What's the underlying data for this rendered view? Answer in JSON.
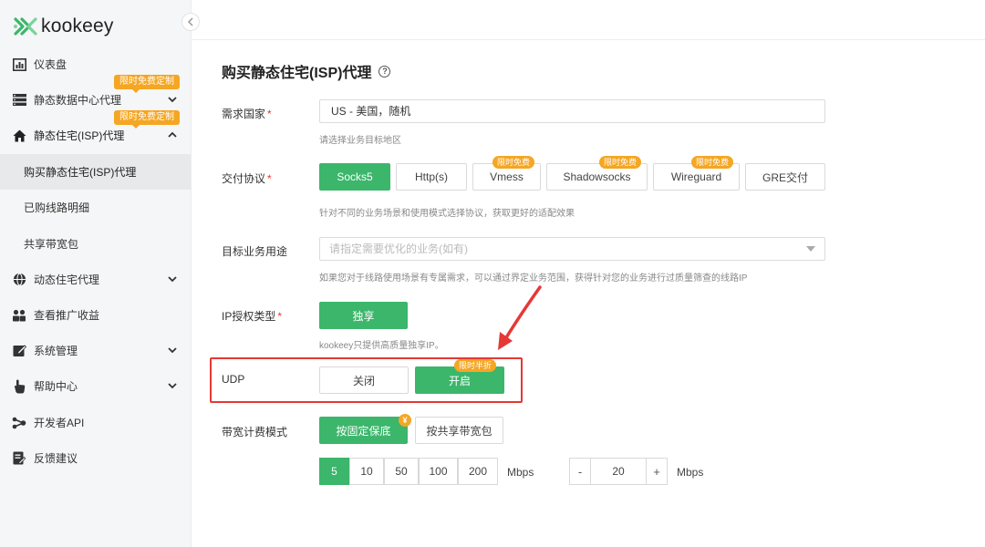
{
  "brand": {
    "name": "kookeey",
    "color": "#3bb66b"
  },
  "sidebar": {
    "collapse_icon": "chevron-left-icon",
    "items": [
      {
        "label": "仪表盘",
        "icon": "dashboard-icon"
      },
      {
        "label": "静态数据中心代理",
        "icon": "server-icon",
        "badge": "限时免费定制"
      },
      {
        "label": "静态住宅(ISP)代理",
        "icon": "home-icon",
        "badge": "限时免费定制"
      },
      {
        "label": "购买静态住宅(ISP)代理"
      },
      {
        "label": "已购线路明细"
      },
      {
        "label": "共享带宽包"
      },
      {
        "label": "动态住宅代理",
        "icon": "globe-icon"
      },
      {
        "label": "查看推广收益",
        "icon": "users-icon"
      },
      {
        "label": "系统管理",
        "icon": "edit-icon"
      },
      {
        "label": "帮助中心",
        "icon": "hand-icon"
      },
      {
        "label": "开发者API",
        "icon": "api-icon"
      },
      {
        "label": "反馈建议",
        "icon": "feedback-icon"
      }
    ]
  },
  "page": {
    "title": "购买静态住宅(ISP)代理",
    "help_icon": "question-circle-icon"
  },
  "form": {
    "country": {
      "label": "需求国家",
      "value": "US - 美国，随机",
      "hint": "请选择业务目标地区"
    },
    "protocol": {
      "label": "交付协议",
      "options": [
        {
          "label": "Socks5"
        },
        {
          "label": "Http(s)"
        },
        {
          "label": "Vmess",
          "tag": "限时免费"
        },
        {
          "label": "Shadowsocks",
          "tag": "限时免费"
        },
        {
          "label": "Wireguard",
          "tag": "限时免费"
        },
        {
          "label": "GRE交付"
        }
      ],
      "selected": "Socks5",
      "hint": "针对不同的业务场景和使用模式选择协议，获取更好的适配效果"
    },
    "purpose": {
      "label": "目标业务用途",
      "placeholder": "请指定需要优化的业务(如有)",
      "hint": "如果您对于线路使用场景有专属需求，可以通过界定业务范围，获得针对您的业务进行过质量筛查的线路IP"
    },
    "ip_type": {
      "label": "IP授权类型",
      "option": "独享",
      "hint": "kookeey只提供高质量独享IP。"
    },
    "udp": {
      "label": "UDP",
      "off": "关闭",
      "on": "开启",
      "tag": "限时半折",
      "selected": "开启"
    },
    "billing": {
      "label": "带宽计费模式",
      "options": [
        {
          "label": "按固定保底"
        },
        {
          "label": "按共享带宽包"
        }
      ],
      "selected": "按固定保底",
      "coin": "¥"
    },
    "bandwidth": {
      "presets": [
        "5",
        "10",
        "50",
        "100",
        "200"
      ],
      "selected": "5",
      "unit": "Mbps",
      "stepper": {
        "minus": "-",
        "value": "20",
        "plus": "+",
        "unit": "Mbps"
      }
    }
  },
  "annotation": {
    "color": "#e53935"
  }
}
